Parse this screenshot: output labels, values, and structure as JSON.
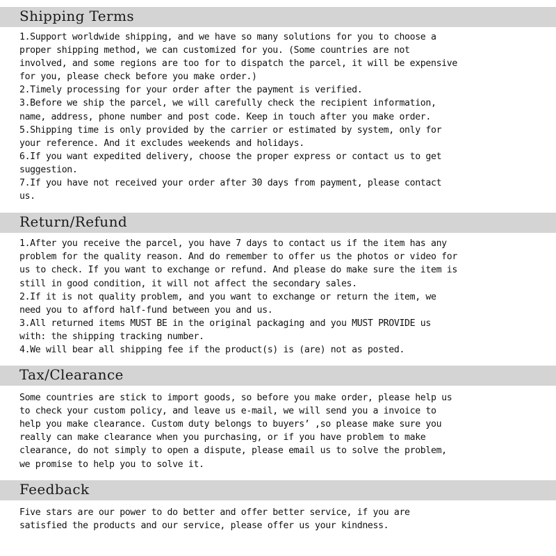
{
  "document": {
    "background_color": "#ffffff",
    "header_band_color": "#d4d4d4",
    "text_color": "#111111"
  },
  "sections": [
    {
      "id": "shipping-terms",
      "heading": "Shipping Terms",
      "lines": [
        "1.Support worldwide shipping, and we have so many solutions for you to choose a",
        "proper shipping method, we can customized for you. (Some countries are not",
        "involved, and some regions are too for to dispatch the parcel, it will be expensive",
        "for you, please check before you make order.)",
        "2.Timely processing for your order after the payment is verified.",
        "3.Before we ship the parcel, we will carefully check the recipient information,",
        "name, address, phone number and post code. Keep in touch after you make order.",
        "5.Shipping time is only provided by the carrier or estimated by system, only for",
        "your reference. And it excludes weekends and holidays.",
        "6.If you want expedited delivery, choose the proper express or contact us to get",
        "suggestion.",
        "7.If you have not received your order after 30 days from payment, please contact",
        "us."
      ]
    },
    {
      "id": "return-refund",
      "heading": "Return/Refund",
      "lines": [
        "1.After you receive the parcel, you have 7 days to contact us if the item has any",
        "problem for the quality reason. And do remember to offer us the photos or video for",
        "us to check. If you want to exchange or refund. And please do make sure the item is",
        "still in good condition, it will not affect the secondary sales.",
        "2.If it is not quality problem, and you want to exchange or return the item, we",
        "need you to afford half-fund between you and us.",
        "3.All returned items MUST BE in the original packaging and you MUST PROVIDE us",
        "with: the shipping tracking number.",
        "4.We will bear all shipping fee if the product(s) is (are) not as posted."
      ]
    },
    {
      "id": "tax-clearance",
      "heading": "Tax/Clearance",
      "lines": [
        "Some countries are stick to import goods, so before you make order, please help us",
        "to check your custom policy, and leave us e-mail, we will send you a invoice to",
        "help you make clearance. Custom duty belongs to buyers’ ,so please make sure you",
        "really can make clearance when you purchasing, or if you have problem to make",
        "clearance, do not simply to open a dispute, please email us to solve the problem,",
        "we promise to help you to solve it."
      ]
    },
    {
      "id": "feedback",
      "heading": "Feedback",
      "lines": [
        "Five stars are our power to do better and offer better service, if you are",
        "satisfied the products and our service, please offer us your kindness."
      ]
    }
  ]
}
